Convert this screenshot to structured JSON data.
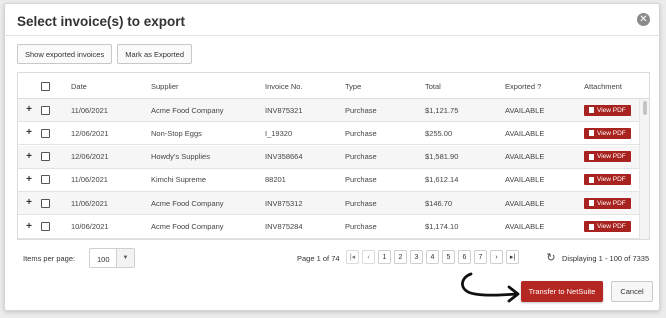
{
  "dialog": {
    "title": "Select invoice(s) to export",
    "close_icon": "close-icon"
  },
  "toolbar": {
    "show_exported_label": "Show exported invoices",
    "mark_exported_label": "Mark as Exported"
  },
  "table": {
    "columns": {
      "date": "Date",
      "supplier": "Supplier",
      "invoice": "Invoice No.",
      "type": "Type",
      "total": "Total",
      "exported": "Exported ?",
      "attachment": "Attachment"
    },
    "rows": [
      {
        "date": "11/06/2021",
        "supplier": "Acme Food Company",
        "invoice": "INV875321",
        "type": "Purchase",
        "total": "$1,121.75",
        "exported": "AVAILABLE",
        "attachment": "View PDF"
      },
      {
        "date": "12/06/2021",
        "supplier": "Non-Stop Eggs",
        "invoice": "I_19320",
        "type": "Purchase",
        "total": "$255.00",
        "exported": "AVAILABLE",
        "attachment": "View PDF"
      },
      {
        "date": "12/06/2021",
        "supplier": "Howdy's Supplies",
        "invoice": "INV358664",
        "type": "Purchase",
        "total": "$1,581.90",
        "exported": "AVAILABLE",
        "attachment": "View PDF"
      },
      {
        "date": "11/06/2021",
        "supplier": "Kimchi Supreme",
        "invoice": "88201",
        "type": "Purchase",
        "total": "$1,612.14",
        "exported": "AVAILABLE",
        "attachment": "View PDF"
      },
      {
        "date": "11/06/2021",
        "supplier": "Acme Food Company",
        "invoice": "INV875312",
        "type": "Purchase",
        "total": "$146.70",
        "exported": "AVAILABLE",
        "attachment": "View PDF"
      },
      {
        "date": "10/06/2021",
        "supplier": "Acme Food Company",
        "invoice": "INV875284",
        "type": "Purchase",
        "total": "$1,174.10",
        "exported": "AVAILABLE",
        "attachment": "View PDF"
      }
    ]
  },
  "pager": {
    "items_per_page_label": "Items per page:",
    "items_per_page_value": "100",
    "page_of": "Page 1 of 74",
    "pages": [
      "1",
      "2",
      "3",
      "4",
      "5",
      "6",
      "7"
    ],
    "displaying": "Displaying 1 - 100 of 7335"
  },
  "footer": {
    "transfer_label": "Transfer to NetSuite",
    "cancel_label": "Cancel"
  },
  "colors": {
    "accent": "#b52722",
    "pdf_badge": "#a8221f"
  }
}
